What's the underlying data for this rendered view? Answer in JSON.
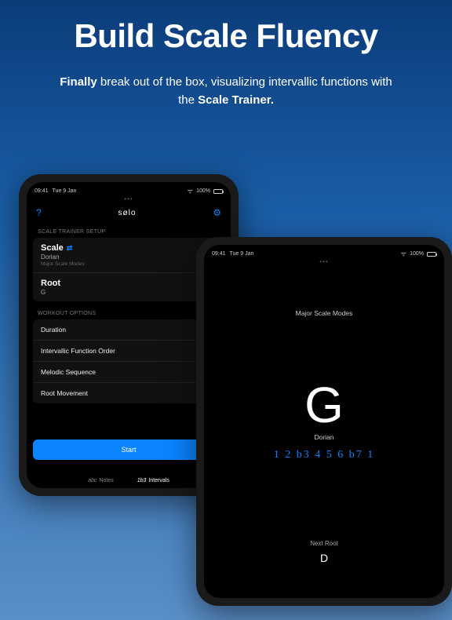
{
  "hero": {
    "title": "Build Scale Fluency",
    "sub_pre": "Finally",
    "sub_mid": " break out of the box, visualizing intervallic functions with the ",
    "sub_bold2": "Scale Trainer.",
    "sub_end": ""
  },
  "status": {
    "time": "09:41",
    "date": "Tue 9 Jan",
    "battery": "100%"
  },
  "left_device": {
    "app_name": "sølo",
    "section_setup": "SCALE TRAINER SETUP",
    "scale_label": "Scale",
    "scale_value": "Dorian",
    "scale_family": "Major Scale Modes",
    "root_label": "Root",
    "root_value": "G",
    "section_workout": "WORKOUT OPTIONS",
    "options": [
      "Duration",
      "Intervallic Function Order",
      "Melodic Sequence",
      "Root Movement"
    ],
    "start_label": "Start",
    "tab_notes_pre": "abc",
    "tab_notes": "Notes",
    "tab_intervals_pre": "1b3",
    "tab_intervals": "Intervals"
  },
  "right_device": {
    "mode": "Major Scale Modes",
    "note": "G",
    "scale": "Dorian",
    "intervals": "1 2 b3 4 5 6 b7 1",
    "next_root_label": "Next Root",
    "next_root": "D"
  }
}
